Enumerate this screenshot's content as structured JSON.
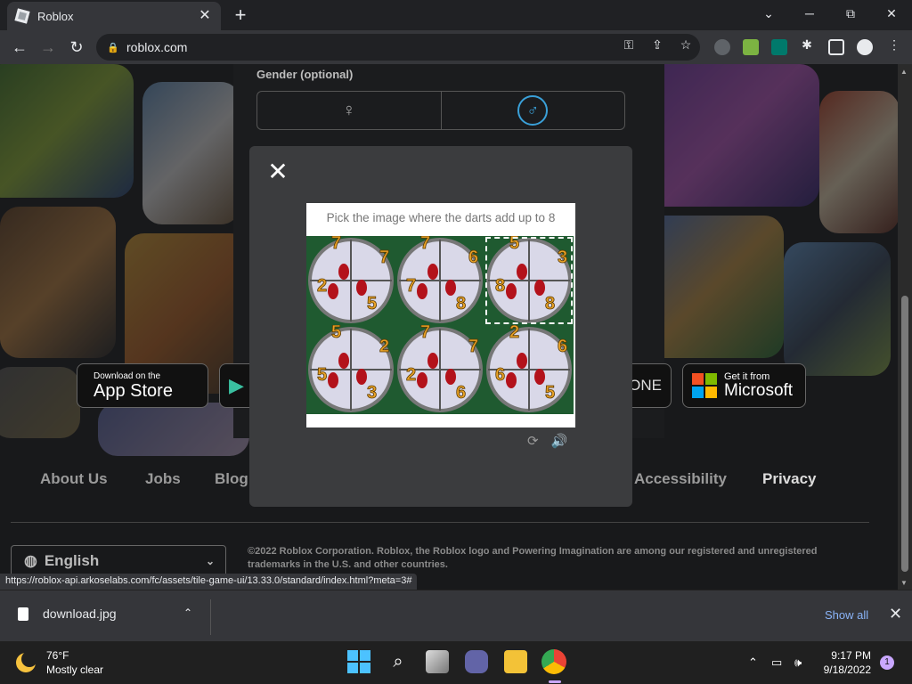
{
  "browser": {
    "tab_title": "Roblox",
    "tab_close": "✕",
    "new_tab": "+",
    "url": "roblox.com",
    "minimize": "─",
    "restore": "⧉",
    "close": "✕",
    "chevron": "⌄",
    "status_url": "https://roblox-api.arkoselabs.com/fc/assets/tile-game-ui/13.33.0/standard/index.html?meta=3#"
  },
  "page": {
    "gender_label": "Gender (optional)",
    "app_store_top": "Download on the",
    "app_store_main": "App Store",
    "xbox_label": "ONE",
    "microsoft_top": "Get it from",
    "microsoft_main": "Microsoft",
    "footer_links": [
      "About Us",
      "Jobs",
      "Blog",
      "Accessibility",
      "Privacy"
    ],
    "language": "English",
    "copyright": "©2022 Roblox Corporation. Roblox, the Roblox logo and Powering Imagination are among our registered and unregistered trademarks in the U.S. and other countries."
  },
  "captcha": {
    "close": "✕",
    "question": "Pick the image where the darts add up to 8",
    "tiles": [
      {
        "nums": [
          "7",
          "7",
          "2",
          "5"
        ]
      },
      {
        "nums": [
          "7",
          "6",
          "7",
          "8"
        ]
      },
      {
        "nums": [
          "5",
          "3",
          "8",
          "8"
        ]
      },
      {
        "nums": [
          "5",
          "2",
          "5",
          "3"
        ]
      },
      {
        "nums": [
          "7",
          "7",
          "2",
          "6"
        ]
      },
      {
        "nums": [
          "2",
          "6",
          "6",
          "5"
        ]
      }
    ],
    "reload_icon": "⟳",
    "audio_icon": "🔊"
  },
  "downloads": {
    "filename": "download.jpg",
    "chevron": "⌃",
    "show_all": "Show all",
    "close": "✕"
  },
  "taskbar": {
    "temperature": "76°F",
    "weather": "Mostly clear",
    "time": "9:17 PM",
    "date": "9/18/2022",
    "notifications": "1"
  }
}
